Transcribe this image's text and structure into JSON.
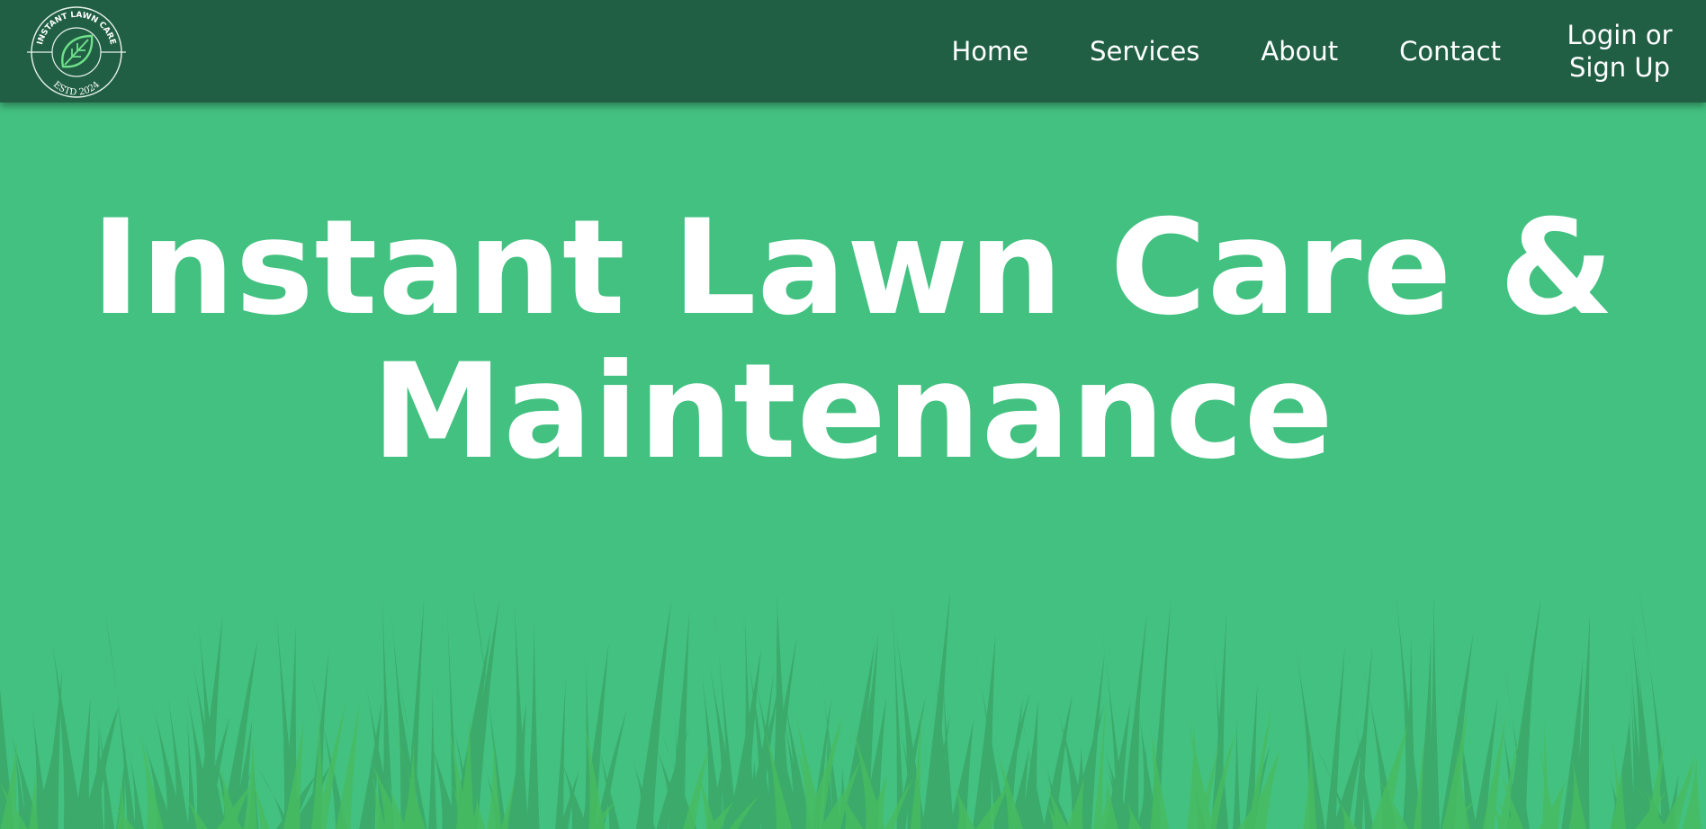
{
  "brand": {
    "logo_top_text": "INSTANT LAWN CARE",
    "logo_bottom_text": "ESTD 2024",
    "logo_icon": "leaf-icon"
  },
  "nav": {
    "items": [
      {
        "label": "Home"
      },
      {
        "label": "Services"
      },
      {
        "label": "About"
      },
      {
        "label": "Contact"
      },
      {
        "label": "Login or Sign Up"
      }
    ]
  },
  "hero": {
    "title_line1": "Instant Lawn Care &",
    "title_line2": "Maintenance"
  },
  "colors": {
    "nav_bg": "#215f45",
    "hero_bg": "#43c181",
    "grass_dark": "#3aa668",
    "grass_light": "#48bc60",
    "text": "#ffffff"
  }
}
